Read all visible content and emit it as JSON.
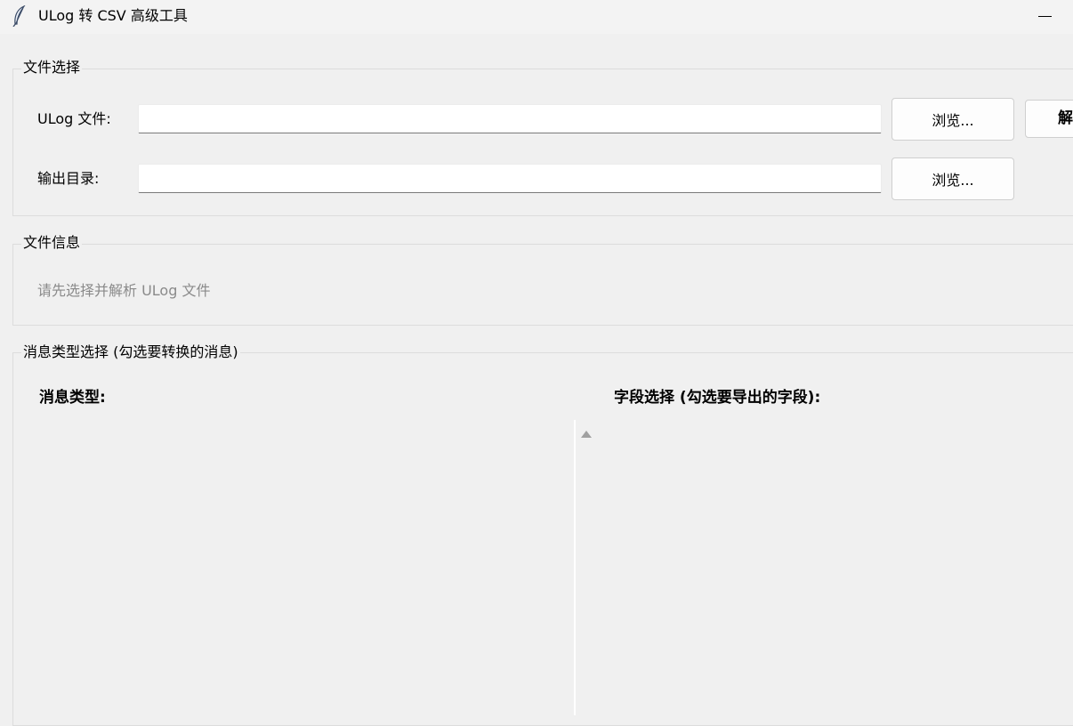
{
  "window": {
    "title": "ULog 转 CSV 高级工具",
    "icon": "feather-icon",
    "controls": {
      "minimize_icon": "minimize-icon"
    }
  },
  "file_selection": {
    "legend": "文件选择",
    "ulog_label": "ULog 文件:",
    "ulog_value": "",
    "ulog_browse_label": "浏览...",
    "parse_button_label": "解析",
    "output_label": "输出目录:",
    "output_value": "",
    "output_browse_label": "浏览..."
  },
  "file_info": {
    "legend": "文件信息",
    "hint": "请先选择并解析 ULog 文件"
  },
  "message_selection": {
    "legend": "消息类型选择 (勾选要转换的消息)",
    "message_types_heading": "消息类型:",
    "fields_heading": "字段选择 (勾选要导出的字段):",
    "message_types": [],
    "fields": []
  },
  "colors": {
    "window_bg": "#f0f0f0",
    "titlebar_bg": "#f3f3f3",
    "input_bg": "#ffffff",
    "hint_text": "#8a8a8a",
    "group_border": "#dcdcdc"
  }
}
